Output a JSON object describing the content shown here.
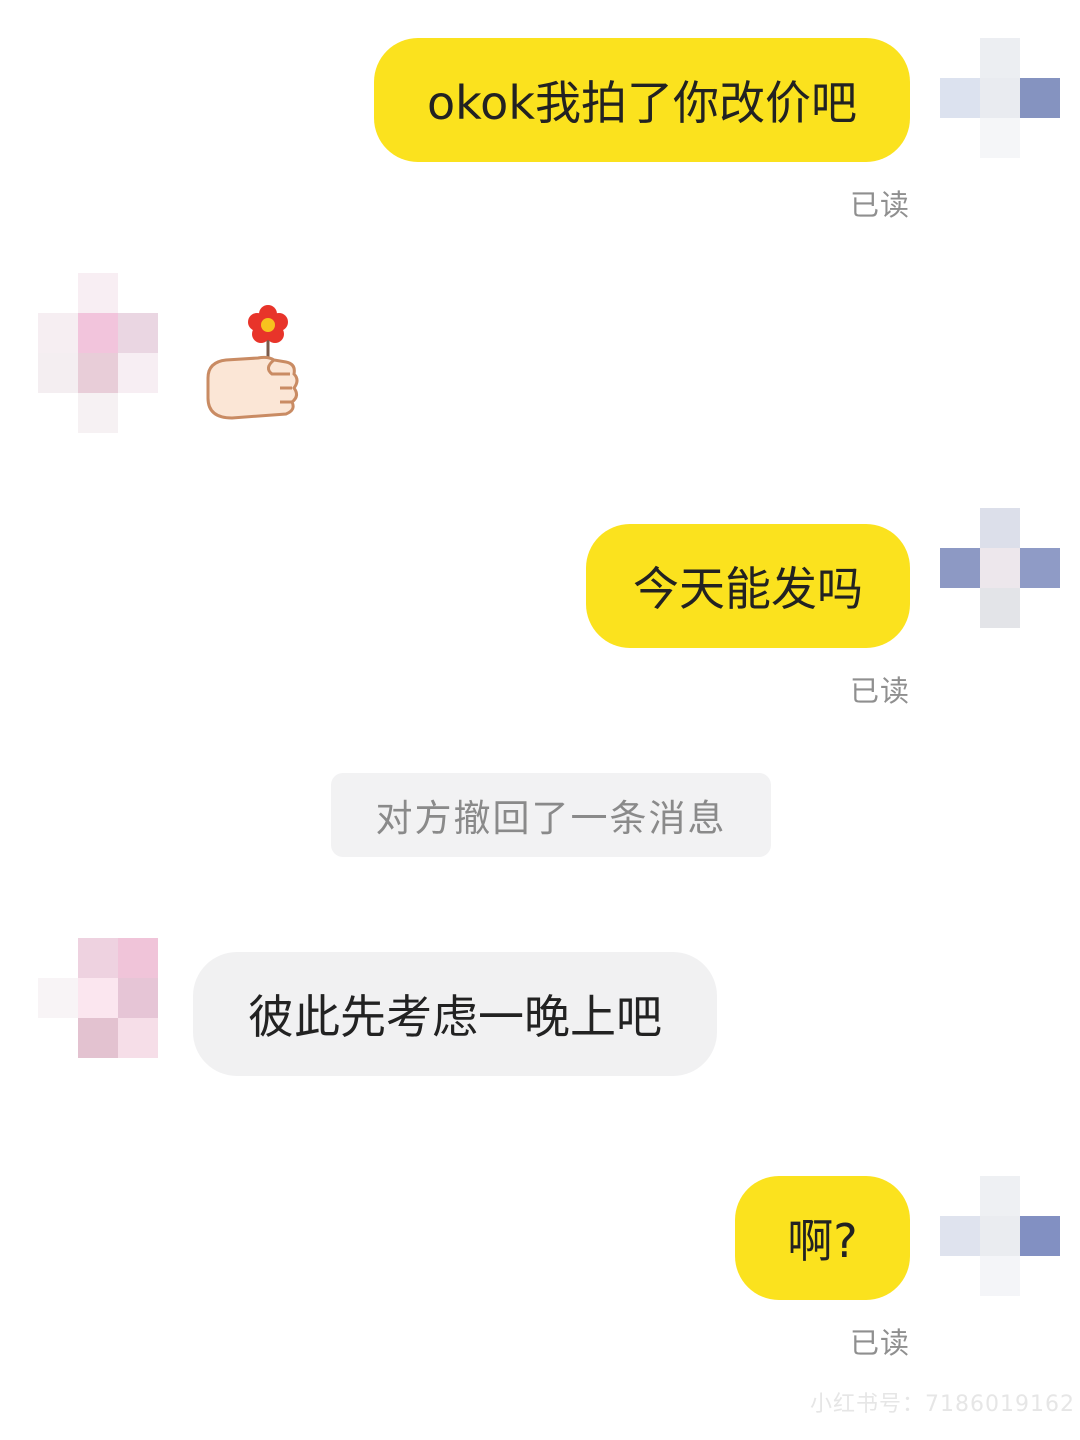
{
  "messages": [
    {
      "sender": "me",
      "text": "okok我拍了你改价吧",
      "status": "已读"
    },
    {
      "sender": "other",
      "type": "sticker",
      "sticker": "hand-holding-flower-icon"
    },
    {
      "sender": "me",
      "text": "今天能发吗",
      "status": "已读"
    },
    {
      "sender": "system",
      "text": "对方撤回了一条消息"
    },
    {
      "sender": "other",
      "text": "彼此先考虑一晚上吧"
    },
    {
      "sender": "me",
      "text": "啊?",
      "status": "已读"
    }
  ],
  "watermark": "小红书号：7186019162",
  "colors": {
    "my_bubble": "#fbe21e",
    "their_bubble": "#f1f1f2",
    "system_notice_bg": "#f2f2f3",
    "read_status": "#8f8f8f"
  },
  "avatars": {
    "me": "blurred-avatar",
    "other": "blurred-avatar"
  }
}
